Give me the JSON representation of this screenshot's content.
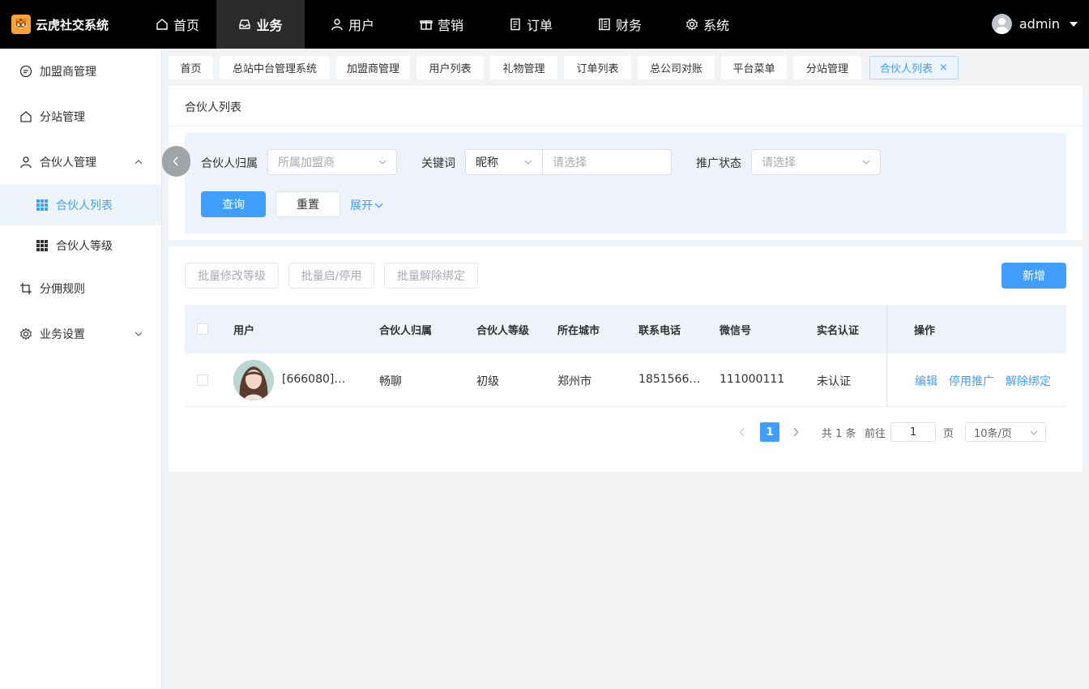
{
  "brand": {
    "name": "云虎社交系统",
    "logo_icon": "tiger-logo"
  },
  "topnav": [
    {
      "label": "首页",
      "icon": "home-icon"
    },
    {
      "label": "业务",
      "icon": "inbox-icon",
      "active": true
    },
    {
      "label": "用户",
      "icon": "user-icon"
    },
    {
      "label": "营销",
      "icon": "gift-icon"
    },
    {
      "label": "订单",
      "icon": "document-icon"
    },
    {
      "label": "财务",
      "icon": "ledger-icon"
    },
    {
      "label": "系统",
      "icon": "gear-icon"
    }
  ],
  "user": {
    "name": "admin"
  },
  "sidebar": {
    "items": [
      {
        "label": "加盟商管理",
        "icon": "chat-icon"
      },
      {
        "label": "分站管理",
        "icon": "home-icon"
      },
      {
        "label": "合伙人管理",
        "icon": "user-icon",
        "expanded": true
      },
      {
        "label": "合伙人列表",
        "icon": "grid-icon",
        "active": true
      },
      {
        "label": "合伙人等级",
        "icon": "grid-icon"
      },
      {
        "label": "分佣规则",
        "icon": "crop-icon"
      },
      {
        "label": "业务设置",
        "icon": "gear-icon"
      }
    ]
  },
  "tabs": [
    "首页",
    "总站中台管理系统",
    "加盟商管理",
    "用户列表",
    "礼物管理",
    "订单列表",
    "总公司对账",
    "平台菜单",
    "分站管理",
    "合伙人列表"
  ],
  "page": {
    "title": "合伙人列表"
  },
  "filter": {
    "belong_label": "合伙人归属",
    "belong_placeholder": "所属加盟商",
    "keyword_label": "关键词",
    "keyword_type": "昵称",
    "keyword_placeholder": "请选择",
    "status_label": "推广状态",
    "status_placeholder": "请选择",
    "query": "查询",
    "reset": "重置",
    "expand": "展开"
  },
  "toolbar": {
    "batch_level": "批量修改等级",
    "batch_toggle": "批量启/停用",
    "batch_unbind": "批量解除绑定",
    "add": "新增"
  },
  "table": {
    "headers": [
      "用户",
      "合伙人归属",
      "合伙人等级",
      "所在城市",
      "联系电话",
      "微信号",
      "实名认证",
      "操作"
    ],
    "rows": [
      {
        "user": "[666080]…",
        "belong": "畅聊",
        "level": "初级",
        "city": "郑州市",
        "phone": "1851566…",
        "wechat": "111000111",
        "verified": "未认证",
        "actions": [
          "编辑",
          "停用推广",
          "解除绑定"
        ]
      }
    ]
  },
  "pagination": {
    "current": "1",
    "total": "共 1 条",
    "goto": "前往",
    "page_value": "1",
    "page_unit": "页",
    "page_size": "10条/页"
  },
  "colors": {
    "primary": "#409eff",
    "topbar": "#000000",
    "filter_bg": "#eef2fb"
  }
}
